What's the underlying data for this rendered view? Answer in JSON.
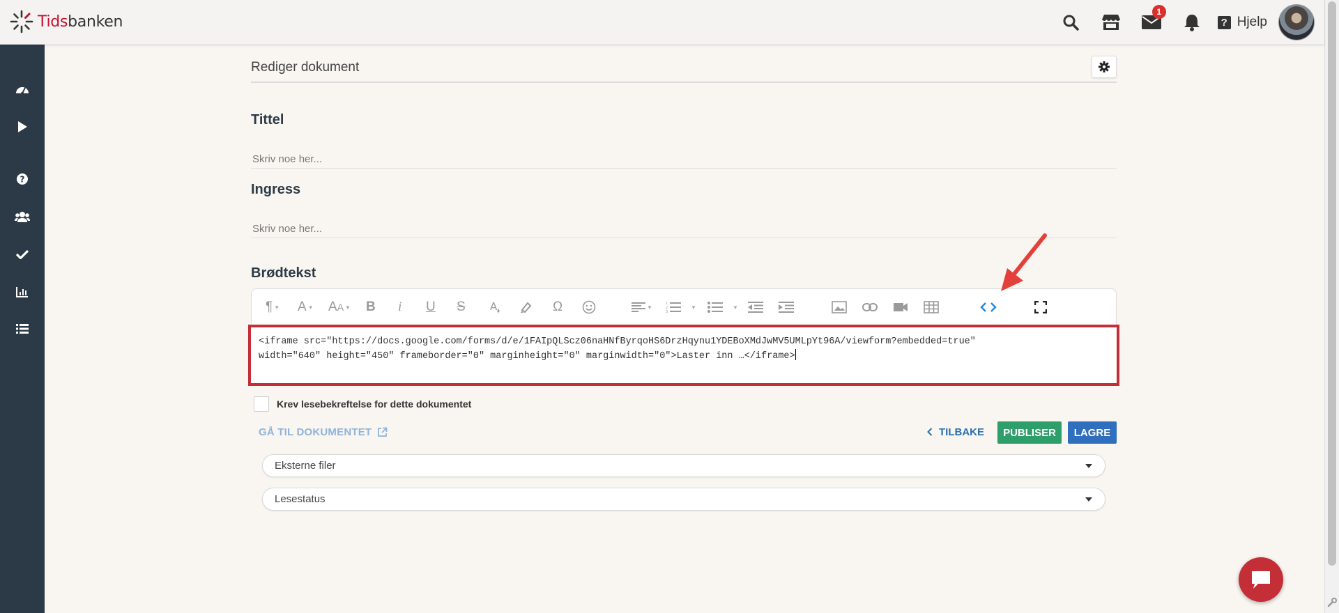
{
  "app": {
    "logo_prefix": "Tids",
    "logo_suffix": "banken"
  },
  "topbar": {
    "messages_badge": "1",
    "help_label": "Hjelp",
    "icons": [
      "search-icon",
      "store-icon",
      "envelope-icon",
      "bell-icon",
      "question-icon"
    ]
  },
  "sidebar": {
    "items": [
      "dashboard-icon",
      "play-icon",
      "question-circle-icon",
      "users-icon",
      "check-icon",
      "chart-icon",
      "list-icon"
    ]
  },
  "document": {
    "header_title": "Rediger dokument",
    "title_label": "Tittel",
    "title_placeholder": "Skriv noe her...",
    "intro_label": "Ingress",
    "intro_placeholder": "Skriv noe her...",
    "body_label": "Brødtekst",
    "code_line1": "<iframe src=\"https://docs.google.com/forms/d/e/1FAIpQLScz06naHNfByrqoHS6DrzHqynu1YDEBoXMdJwMV5UMLpYt96A/viewform?embedded=true\"",
    "code_line2": "width=\"640\" height=\"450\" frameborder=\"0\" marginheight=\"0\" marginwidth=\"0\">Laster inn …</iframe>",
    "read_confirm_label": "Krev lesebekreftelse for dette dokumentet",
    "goto_label": "GÅ TIL DOKUMENTET",
    "back_label": "TILBAKE",
    "publish_label": "PUBLISER",
    "save_label": "LAGRE",
    "external_files_label": "Eksterne filer",
    "read_status_label": "Lesestatus"
  },
  "toolbar": {
    "buttons": [
      "paragraph-format-icon",
      "font-family-icon",
      "font-size-icon",
      "bold-icon",
      "italic-icon",
      "underline-icon",
      "strikethrough-icon",
      "text-color-icon",
      "highlight-icon",
      "special-characters-icon",
      "emoticons-icon",
      "align-icon",
      "ordered-list-icon",
      "unordered-list-icon",
      "outdent-icon",
      "indent-icon",
      "insert-image-icon",
      "insert-link-icon",
      "insert-video-icon",
      "insert-table-icon",
      "code-view-icon",
      "fullscreen-icon"
    ]
  },
  "colors": {
    "sidebar": "#2c3a47",
    "accent_red": "#c42e37",
    "publish_green": "#2e9e6b",
    "save_blue": "#2f6fbd",
    "code_view_active": "#1e88e5"
  }
}
